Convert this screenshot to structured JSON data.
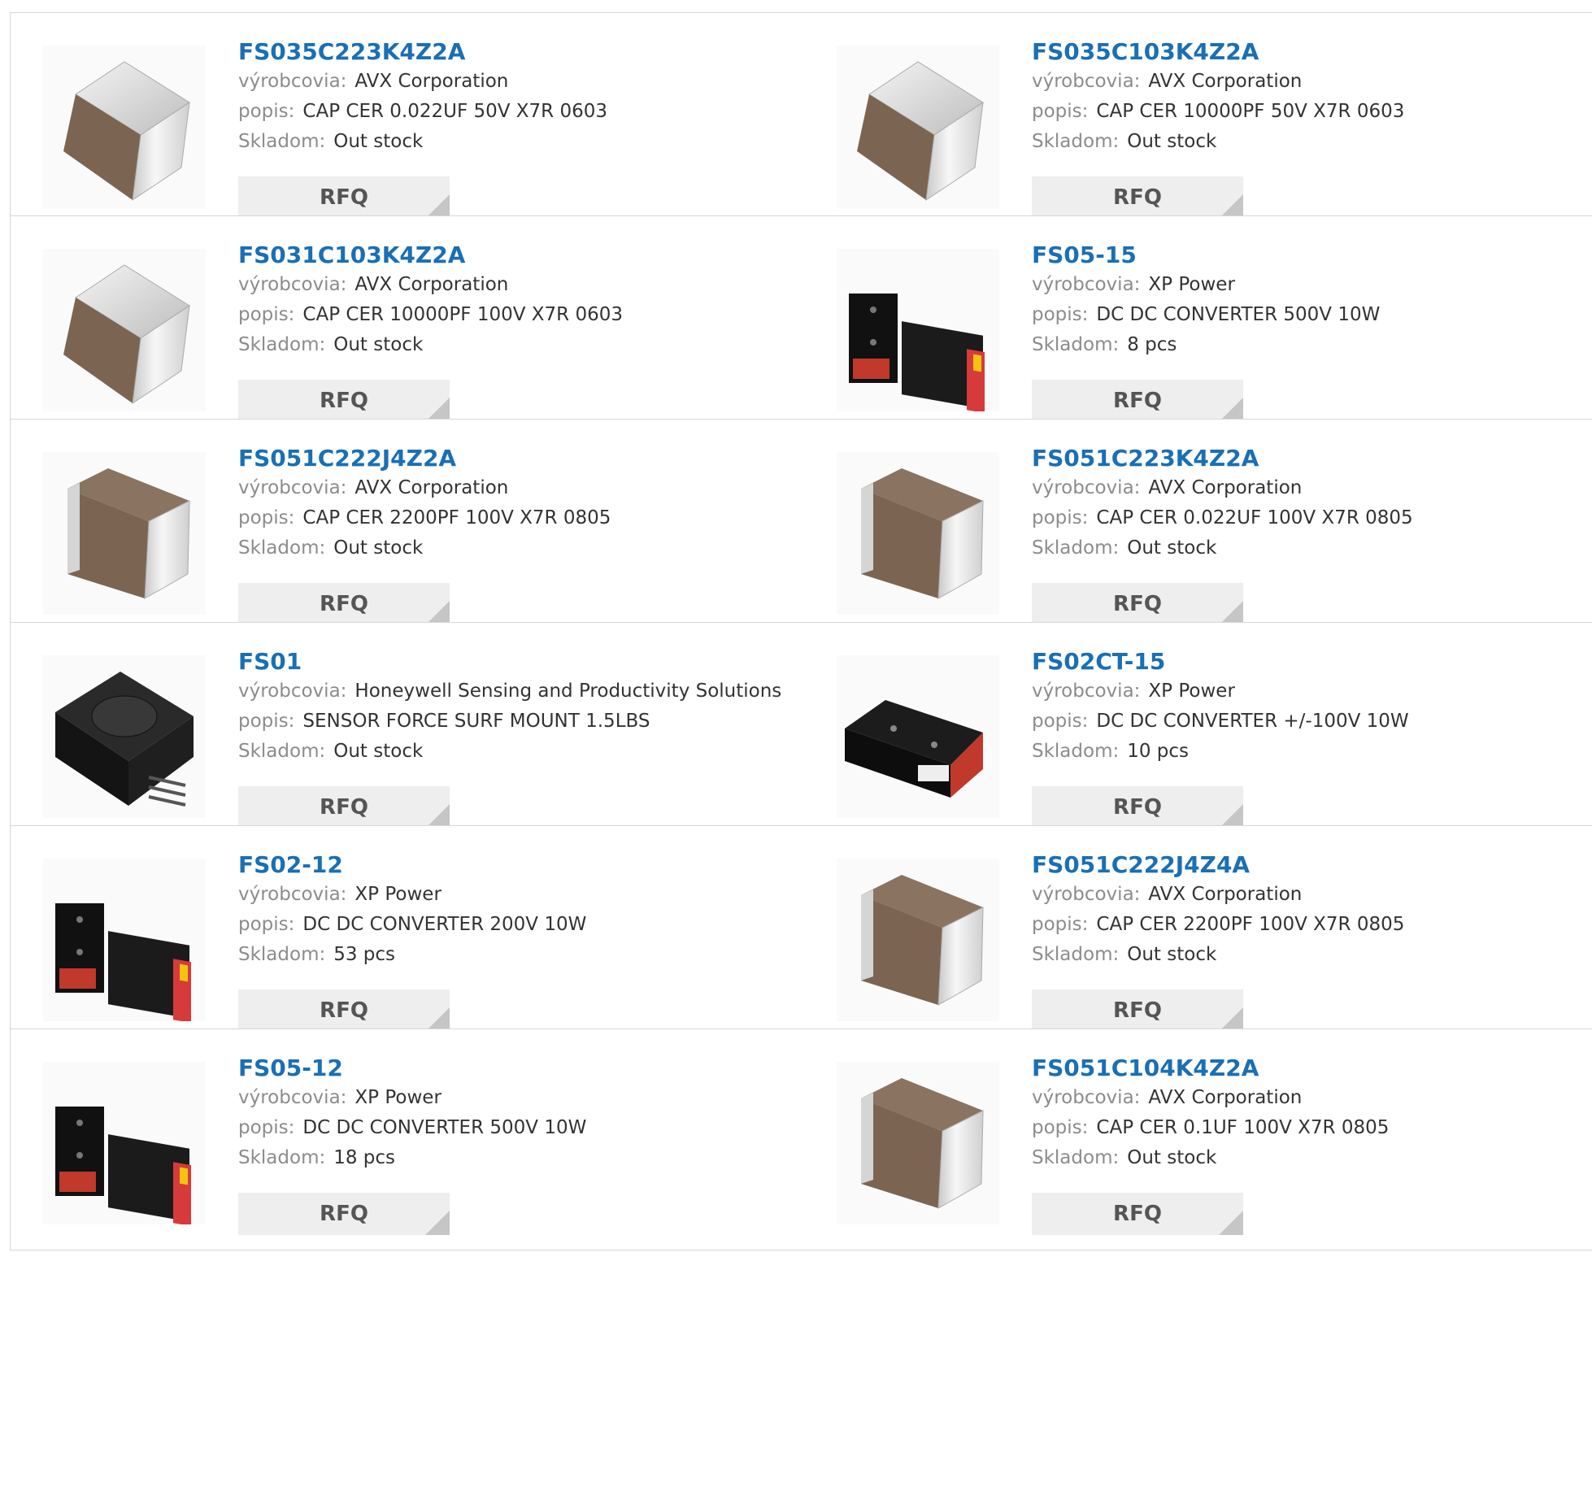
{
  "labels": {
    "manufacturer": "výrobcovia:",
    "description": "popis:",
    "stock": "Skladom:",
    "rfq": "RFQ"
  },
  "products": [
    {
      "pn": "FS035C223K4Z2A",
      "manufacturer": "AVX Corporation",
      "description": "CAP CER 0.022UF 50V X7R 0603",
      "stock": "Out stock",
      "image": "capacitor-chip-top"
    },
    {
      "pn": "FS035C103K4Z2A",
      "manufacturer": "AVX Corporation",
      "description": "CAP CER 10000PF 50V X7R 0603",
      "stock": "Out stock",
      "image": "capacitor-chip-top"
    },
    {
      "pn": "FS031C103K4Z2A",
      "manufacturer": "AVX Corporation",
      "description": "CAP CER 10000PF 100V X7R 0603",
      "stock": "Out stock",
      "image": "capacitor-chip-top"
    },
    {
      "pn": "FS05-15",
      "manufacturer": "XP Power",
      "description": "DC DC CONVERTER 500V 10W",
      "stock": "8 pcs",
      "image": "dc-converter-pair"
    },
    {
      "pn": "FS051C222J4Z2A",
      "manufacturer": "AVX Corporation",
      "description": "CAP CER 2200PF 100V X7R 0805",
      "stock": "Out stock",
      "image": "capacitor-chip-side"
    },
    {
      "pn": "FS051C223K4Z2A",
      "manufacturer": "AVX Corporation",
      "description": "CAP CER 0.022UF 100V X7R 0805",
      "stock": "Out stock",
      "image": "capacitor-chip-side"
    },
    {
      "pn": "FS01",
      "manufacturer": "Honeywell Sensing and Productivity Solutions",
      "description": "SENSOR FORCE SURF MOUNT 1.5LBS",
      "stock": "Out stock",
      "image": "force-sensor"
    },
    {
      "pn": "FS02CT-15",
      "manufacturer": "XP Power",
      "description": "DC DC CONVERTER +/-100V 10W",
      "stock": "10 pcs",
      "image": "dc-converter-single"
    },
    {
      "pn": "FS02-12",
      "manufacturer": "XP Power",
      "description": "DC DC CONVERTER 200V 10W",
      "stock": "53 pcs",
      "image": "dc-converter-pair"
    },
    {
      "pn": "FS051C222J4Z4A",
      "manufacturer": "AVX Corporation",
      "description": "CAP CER 2200PF 100V X7R 0805",
      "stock": "Out stock",
      "image": "capacitor-chip-side"
    },
    {
      "pn": "FS05-12",
      "manufacturer": "XP Power",
      "description": "DC DC CONVERTER 500V 10W",
      "stock": "18 pcs",
      "image": "dc-converter-pair"
    },
    {
      "pn": "FS051C104K4Z2A",
      "manufacturer": "AVX Corporation",
      "description": "CAP CER 0.1UF 100V X7R 0805",
      "stock": "Out stock",
      "image": "capacitor-chip-side"
    }
  ],
  "colors": {
    "part_number": "#1a6fb5",
    "label": "#8c8c8c",
    "value": "#333333",
    "rfq_bg": "#eeeeee",
    "border": "#d6d6d6"
  }
}
